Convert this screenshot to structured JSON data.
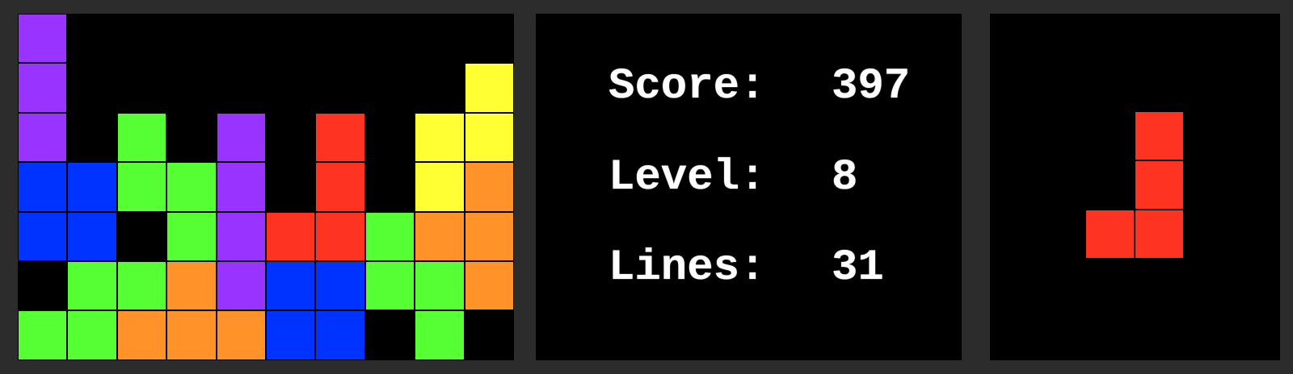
{
  "colors": {
    "background": "#2c2c2c",
    "panel": "#000000",
    "P": "#9933ff",
    "G": "#55ff33",
    "B": "#0033ff",
    "R": "#ff3322",
    "Y": "#ffff33",
    "O": "#ff9228"
  },
  "board": {
    "columns": 10,
    "grid": [
      "P.........",
      "P........Y",
      "P.G.P.R.YY",
      "BBGGP.R.YO",
      "BB.GPRRGOO",
      ".GGOPBBGGO",
      "GGOOOBB.G."
    ]
  },
  "stats": {
    "score_label": "Score:",
    "score_value": "397",
    "level_label": "Level:",
    "level_value": "8",
    "lines_label": "Lines:",
    "lines_value": "31"
  },
  "next_piece": {
    "name": "J",
    "color": "R",
    "grid": [
      ".R",
      ".R",
      "RR"
    ]
  }
}
